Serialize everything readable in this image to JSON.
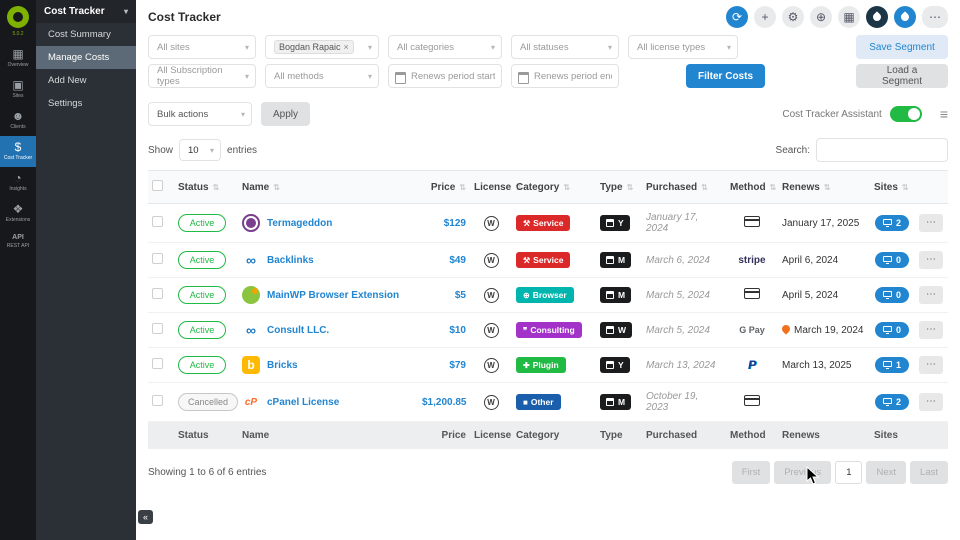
{
  "app": {
    "title": "Cost Tracker",
    "version": "5.0.2"
  },
  "icons": {
    "refresh": "⟳",
    "plus": "+",
    "gear": "⚙",
    "globe": "⊕",
    "grid": "▦",
    "more": "⋯",
    "menu": "≡",
    "caret": "▾",
    "close": "×",
    "overview": "▦",
    "sites": "▣",
    "clients": "☻",
    "cost": "$",
    "insights": "◔",
    "extensions": "❖",
    "service": "⚒",
    "browser": "⊕",
    "consulting": "❞",
    "plugin": "✚",
    "other": "■"
  },
  "iconbar": {
    "items": [
      {
        "label": "Overview"
      },
      {
        "label": "Sites"
      },
      {
        "label": "Clients"
      },
      {
        "label": "Cost Tracker"
      },
      {
        "label": "Insights"
      },
      {
        "label": "Extensions"
      },
      {
        "label": "API",
        "sublabel": "REST API"
      }
    ]
  },
  "sidebar": {
    "title": "Cost Tracker",
    "items": [
      {
        "label": "Cost Summary"
      },
      {
        "label": "Manage Costs"
      },
      {
        "label": "Add New"
      },
      {
        "label": "Settings"
      }
    ]
  },
  "filters": {
    "sites": "All sites",
    "client_tag": "Bogdan Rapaic",
    "categories": "All categories",
    "statuses": "All statuses",
    "license_types": "All license types",
    "subscription_types": "All Subscription types",
    "methods": "All methods",
    "renews_start": "Renews period start date",
    "renews_end": "Renews period end date",
    "filter_button": "Filter Costs",
    "save_segment": "Save Segment",
    "load_segment": "Load a Segment"
  },
  "toolbar": {
    "bulk_actions": "Bulk actions",
    "apply": "Apply",
    "assistant_label": "Cost Tracker Assistant",
    "show": "Show",
    "page_size": "10",
    "entries": "entries",
    "search_label": "Search:"
  },
  "table": {
    "columns": [
      "Status",
      "Name",
      "Price",
      "License",
      "Category",
      "Type",
      "Purchased",
      "Method",
      "Renews",
      "Sites"
    ],
    "rows": [
      {
        "status": "Active",
        "icon": "",
        "name": "Termageddon",
        "price": "$129",
        "license": "W",
        "category": "Service",
        "type": "Y",
        "purchased": "January 17, 2024",
        "method": "card",
        "renews": "January 17, 2025",
        "sites": "2"
      },
      {
        "status": "Active",
        "icon": "∞",
        "name": "Backlinks",
        "price": "$49",
        "license": "W",
        "category": "Service",
        "type": "M",
        "purchased": "March 6, 2024",
        "method": "stripe",
        "renews": "April 6, 2024",
        "sites": "0"
      },
      {
        "status": "Active",
        "icon": "",
        "name": "MainWP Browser Extension",
        "price": "$5",
        "license": "W",
        "category": "Browser",
        "type": "M",
        "purchased": "March 5, 2024",
        "method": "card",
        "renews": "April 5, 2024",
        "sites": "0"
      },
      {
        "status": "Active",
        "icon": "∞",
        "name": "Consult LLC.",
        "price": "$10",
        "license": "W",
        "category": "Consulting",
        "type": "W",
        "purchased": "March 5, 2024",
        "method": "G Pay",
        "renews": "March 19, 2024",
        "sites": "0"
      },
      {
        "status": "Active",
        "icon": "b",
        "name": "Bricks",
        "price": "$79",
        "license": "W",
        "category": "Plugin",
        "type": "Y",
        "purchased": "March 13, 2024",
        "method": "P",
        "renews": "March 13, 2025",
        "sites": "1"
      },
      {
        "status": "Cancelled",
        "icon": "cP",
        "name": "cPanel License",
        "price": "$1,200.85",
        "license": "W",
        "category": "Other",
        "type": "M",
        "purchased": "October 19, 2023",
        "method": "card",
        "renews": "",
        "sites": "2"
      }
    ]
  },
  "footer": {
    "showing": "Showing 1 to 6 of 6 entries",
    "pagination": {
      "first": "First",
      "previous": "Previous",
      "page": "1",
      "next": "Next",
      "last": "Last"
    }
  },
  "misc": {
    "collapse": "«"
  },
  "colors": {
    "accent": "#2185d0",
    "green": "#21ba45",
    "service": "#db2828",
    "browser": "#00b5ad",
    "consulting": "#a333c8",
    "plugin": "#21ba45",
    "other": "#1b5eab",
    "sidebar_active": "#5b6a76",
    "iconbar_active": "#2271b1"
  }
}
